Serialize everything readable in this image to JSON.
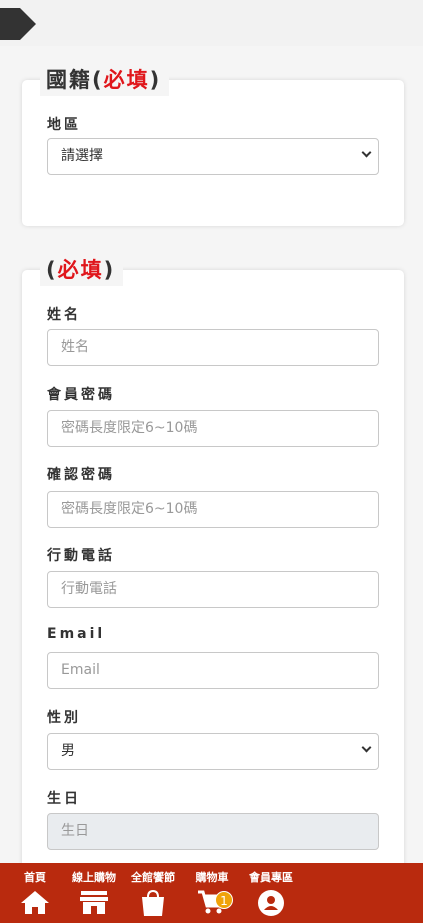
{
  "nationality_section": {
    "title_prefix": "國籍(",
    "required_mark": "必填",
    "title_suffix": ")",
    "region_label": "地區",
    "region_value": "請選擇"
  },
  "member_section": {
    "title_prefix": "(",
    "required_mark": "必填",
    "title_suffix": ")",
    "name_label": "姓名",
    "name_placeholder": "姓名",
    "password_label": "會員密碼",
    "password_placeholder": "密碼長度限定6~10碼",
    "confirm_label": "確認密碼",
    "confirm_placeholder": "密碼長度限定6~10碼",
    "mobile_label": "行動電話",
    "mobile_placeholder": "行動電話",
    "email_label": "Email",
    "email_placeholder": "Email",
    "gender_label": "性別",
    "gender_value": "男",
    "birthday_label": "生日",
    "birthday_placeholder": "生日"
  },
  "bottom_nav": {
    "items": [
      {
        "label": "首頁",
        "icon": "home-icon"
      },
      {
        "label": "線上購物",
        "icon": "store-icon"
      },
      {
        "label": "全館饗節",
        "icon": "shopping-bag-icon"
      },
      {
        "label": "購物車",
        "icon": "cart-icon"
      },
      {
        "label": "會員專區",
        "icon": "user-icon"
      }
    ],
    "cart_count": "1"
  },
  "colors": {
    "accent": "#b92a0e",
    "required": "#e0161b",
    "badge": "#f0a30a"
  }
}
